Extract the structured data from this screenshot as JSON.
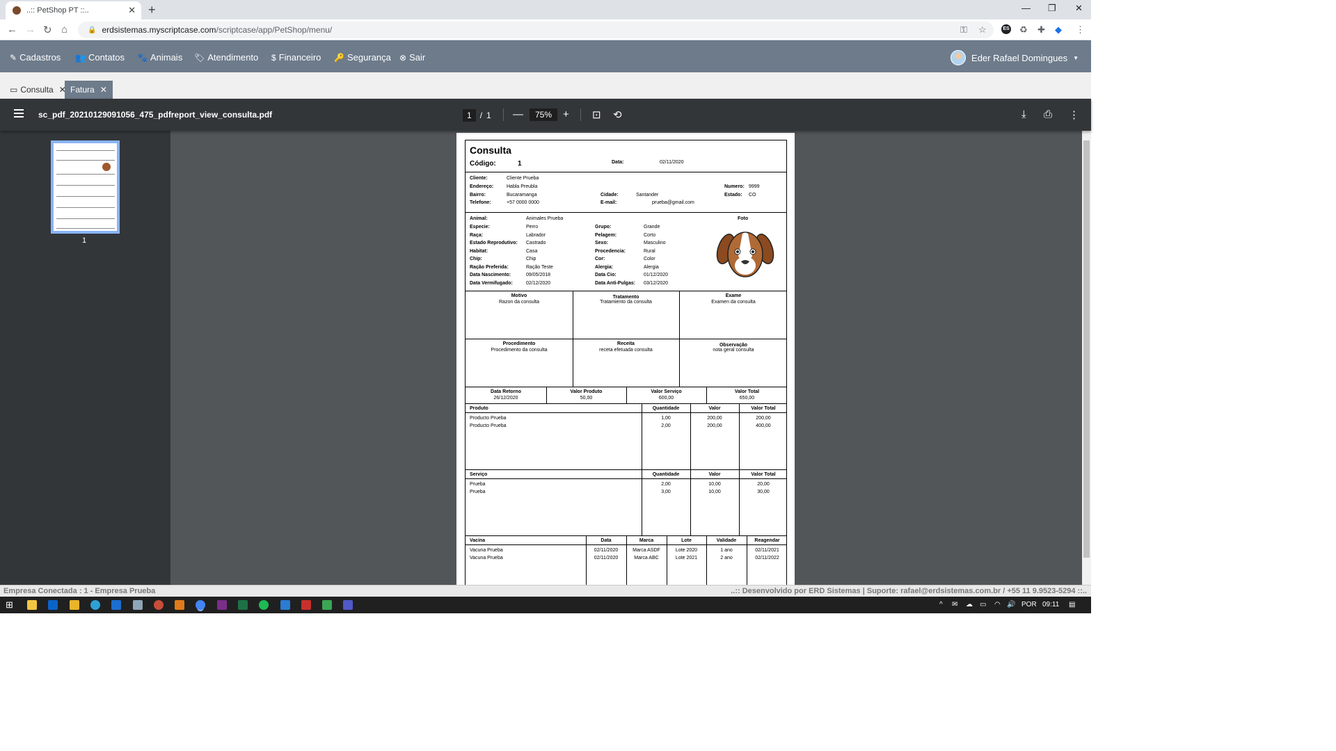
{
  "browser": {
    "tab_title": "..:: PetShop PT ::..",
    "url_host": "erdsistemas.myscriptcase.com",
    "url_path": "/scriptcase/app/PetShop/menu/",
    "extension_es": "ES"
  },
  "menu": {
    "items": [
      "Cadastros",
      "Contatos",
      "Animais",
      "Atendimento",
      "Financeiro",
      "Segurança",
      "Sair"
    ],
    "user": "Eder Rafael Domingues"
  },
  "app_tabs": [
    "Consulta",
    "Fatura"
  ],
  "pdf_viewer": {
    "filename": "sc_pdf_20210129091056_475_pdfreport_view_consulta.pdf",
    "page_current": "1",
    "page_sep": "/",
    "page_total": "1",
    "zoom": "75%",
    "thumb_label": "1"
  },
  "doc": {
    "title": "Consulta",
    "codigo_label": "Código:",
    "codigo_value": "1",
    "data_label": "Data:",
    "data_value": "02/11/2020",
    "cliente": {
      "cliente_l": "Cliente:",
      "cliente_v": "Cliente Prueba",
      "endereco_l": "Endereço:",
      "endereco_v": "Habla Preubla",
      "bairro_l": "Bairro:",
      "bairro_v": "Bucaramanga",
      "telefone_l": "Telefone:",
      "telefone_v": "+57 0000 0000",
      "numero_l": "Numero:",
      "numero_v": "9999",
      "cidade_l": "Cidade:",
      "cidade_v": "Santander",
      "estado_l": "Estado:",
      "estado_v": "CO",
      "email_l": "E-mail:",
      "email_v": "prueba@gmail.com"
    },
    "animal": {
      "animal_l": "Animal:",
      "animal_v": "Animales Prueba",
      "especie_l": "Especie:",
      "especie_v": "Perro",
      "raca_l": "Raça:",
      "raca_v": "Labrador",
      "estado_rep_l": "Estado Reprodutivo:",
      "estado_rep_v": "Castrado",
      "habitat_l": "Habitat:",
      "habitat_v": "Casa",
      "chip_l": "Chip:",
      "chip_v": "Chip",
      "racao_l": "Ração Preferida:",
      "racao_v": "Ração Teste",
      "nascimento_l": "Data Nascimento:",
      "nascimento_v": "09/05/2018",
      "vermifugado_l": "Data Vermifugado:",
      "vermifugado_v": "02/12/2020",
      "grupo_l": "Grupo:",
      "grupo_v": "Grande",
      "pelagem_l": "Pelagem:",
      "pelagem_v": "Corto",
      "sexo_l": "Sexo:",
      "sexo_v": "Masculino",
      "procedencia_l": "Procedencia:",
      "procedencia_v": "Rural",
      "cor_l": "Cor:",
      "cor_v": "Color",
      "alergia_l": "Alergia:",
      "alergia_v": "Alergia",
      "cio_l": "Data Cio:",
      "cio_v": "01/12/2020",
      "antipulgas_l": "Data Anti-Pulgas:",
      "antipulgas_v": "03/12/2020",
      "foto_l": "Foto"
    },
    "notes": [
      {
        "label": "Motivo",
        "value": "Razon da consulta"
      },
      {
        "label": "Tratamento",
        "value": "Tratamiento da consulta"
      },
      {
        "label": "Exame",
        "value": "Examen da consulta"
      },
      {
        "label": "Procedimento",
        "value": "Procedimento da consulta"
      },
      {
        "label": "Receita",
        "value": "receta efetuada consulta"
      },
      {
        "label": "Observação",
        "value": "nota geral consulta"
      }
    ],
    "totals": [
      {
        "label": "Data Retorno",
        "value": "26/12/2020"
      },
      {
        "label": "Valor Produto",
        "value": "50,00"
      },
      {
        "label": "Valor Serviço",
        "value": "600,00"
      },
      {
        "label": "Valor Total",
        "value": "650,00"
      }
    ],
    "produtos": {
      "headers": [
        "Produto",
        "Quantidade",
        "Valor",
        "Valor Total"
      ],
      "rows": [
        [
          "Producto Prueba",
          "1,00",
          "200,00",
          "200,00"
        ],
        [
          "Producto Prueba",
          "2,00",
          "200,00",
          "400,00"
        ]
      ]
    },
    "servicos": {
      "headers": [
        "Serviço",
        "Quantidade",
        "Valor",
        "Valor Total"
      ],
      "rows": [
        [
          "Prueba",
          "2,00",
          "10,00",
          "20,00"
        ],
        [
          "Prueba",
          "3,00",
          "10,00",
          "30,00"
        ]
      ]
    },
    "vacinas": {
      "headers": [
        "Vacina",
        "Data",
        "Marca",
        "Lote",
        "Validade",
        "Reagendar"
      ],
      "rows": [
        [
          "Vacuna Prueba",
          "02/11/2020",
          "Marca ASDF",
          "Lote 2020",
          "1 ano",
          "02/11/2021"
        ],
        [
          "Vacuna Prueba",
          "02/11/2020",
          "Marca ABC",
          "Lote 2021",
          "2 ano",
          "02/11/2022"
        ]
      ]
    }
  },
  "status": {
    "left": "Empresa Conectada : 1 - Empresa Prueba",
    "right": "..:: Desenvolvido por ERD Sistemas | Suporte: rafael@erdsistemas.com.br / +55 11 9.9523-5294 ::.."
  },
  "taskbar": {
    "lang": "POR",
    "time": "09:11"
  }
}
